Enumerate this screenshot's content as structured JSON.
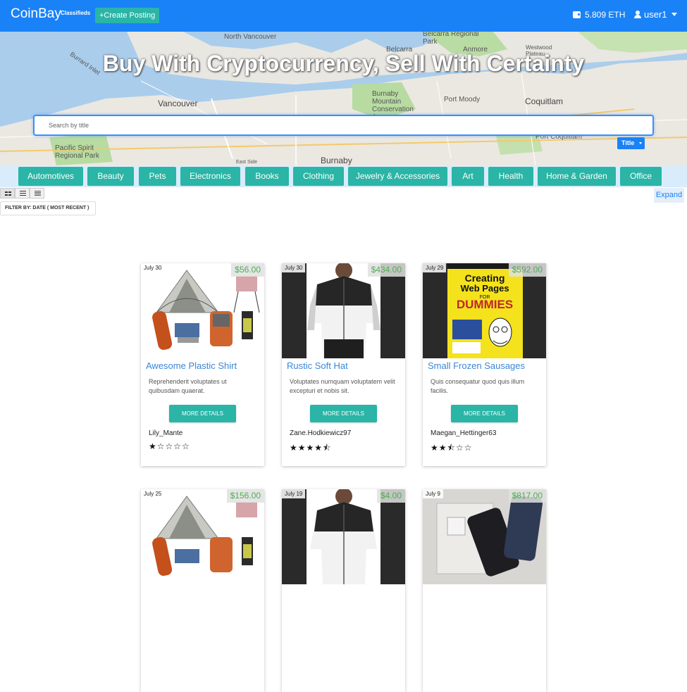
{
  "navbar": {
    "brand": "CoinBay",
    "brand_sub": "Classifieds",
    "create_label": "+Create Posting",
    "balance": "5.809 ETH",
    "username": "user1"
  },
  "hero": {
    "title": "Buy With Cryptocurrency, Sell With Certainty",
    "search_placeholder": "Search by title",
    "search_mode": "Title",
    "map_labels": [
      "North Vancouver",
      "Vancouver",
      "Burnaby",
      "Burnaby Mountain Conservation Area",
      "Port Moody",
      "Coquitlam",
      "Belcarra",
      "Anmore",
      "Belcarra Regional Park",
      "Westwood Plateau",
      "Pacific Spirit Regional Park",
      "Burrard Inlet",
      "Port Coquitlam",
      "East Side"
    ]
  },
  "categories": [
    "Automotives",
    "Beauty",
    "Pets",
    "Electronics",
    "Books",
    "Clothing",
    "Jewelry & Accessories",
    "Art",
    "Health",
    "Home & Garden",
    "Office"
  ],
  "toolbar": {
    "expand_label": "Expand",
    "filter_label": "FILTER BY: DATE ( MOST RECENT )"
  },
  "listings": [
    {
      "date": "July 30",
      "price": "$56.00",
      "title": "Awesome Plastic Shirt",
      "desc": "Reprehenderit voluptates ut quibusdam quaerat.",
      "button": "MORE DETAILS",
      "user": "Lily_Mante",
      "stars": "★☆☆☆☆",
      "image": "camping-gear"
    },
    {
      "date": "July 30",
      "price": "$434.00",
      "title": "Rustic Soft Hat",
      "desc": "Voluptates numquam voluptatem velit excepturi et nobis sit.",
      "button": "MORE DETAILS",
      "user": "Zane.Hodkiewicz97",
      "stars": "★★★★⯪",
      "image": "windbreaker"
    },
    {
      "date": "July 29",
      "price": "$592.00",
      "title": "Small Frozen Sausages",
      "desc": "Quis consequatur quod quis illum facilis.",
      "button": "MORE DETAILS",
      "user": "Maegan_Hettinger63",
      "stars": "★★⯪☆☆",
      "image": "book"
    },
    {
      "date": "July 25",
      "price": "$156.00",
      "image": "camping-gear"
    },
    {
      "date": "July 19",
      "price": "$4.00",
      "image": "windbreaker"
    },
    {
      "date": "July 9",
      "price": "$817.00",
      "image": "phone"
    }
  ],
  "book_cover": {
    "line1": "Creating",
    "line2": "Web Pages",
    "line3": "FOR",
    "line4": "DUMMIES"
  }
}
